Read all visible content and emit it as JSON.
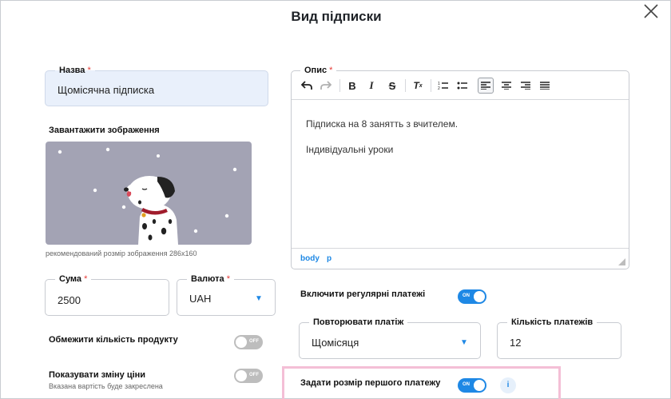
{
  "dialog": {
    "title": "Вид підписки"
  },
  "name": {
    "label": "Назва",
    "required_mark": "*",
    "value": "Щомісячна підписка"
  },
  "image_upload": {
    "label": "Завантажити зображення",
    "hint": "рекомендований розмір зображення 286x160"
  },
  "sum": {
    "label": "Сума",
    "required_mark": "*",
    "value": "2500"
  },
  "currency": {
    "label": "Валюта",
    "required_mark": "*",
    "value": "UAH"
  },
  "limit_product": {
    "label": "Обмежити кількість продукту",
    "toggle_text": "OFF",
    "enabled": false
  },
  "show_price_change": {
    "label": "Показувати зміну ціни",
    "sublabel": "Вказана вартість буде закреслена",
    "toggle_text": "OFF",
    "enabled": false
  },
  "description": {
    "label": "Опис",
    "required_mark": "*",
    "paragraphs": [
      "Підписка на 8 занятть з вчителем.",
      "Індивідуальні уроки"
    ],
    "status_path": [
      "body",
      "p"
    ]
  },
  "editor_toolbar": {
    "buttons": [
      {
        "name": "undo-icon",
        "glyph": "↶"
      },
      {
        "name": "redo-icon",
        "glyph": "↷"
      },
      {
        "name": "bold-icon",
        "glyph": "B"
      },
      {
        "name": "italic-icon",
        "glyph": "I"
      },
      {
        "name": "strikethrough-icon",
        "glyph": "S"
      },
      {
        "name": "clear-format-icon",
        "glyph": "Tx"
      },
      {
        "name": "ordered-list-icon",
        "glyph": "1≡"
      },
      {
        "name": "bullet-list-icon",
        "glyph": "•≡"
      },
      {
        "name": "align-left-icon",
        "glyph": "≡"
      },
      {
        "name": "align-center-icon",
        "glyph": "≡"
      },
      {
        "name": "align-right-icon",
        "glyph": "≡"
      },
      {
        "name": "align-justify-icon",
        "glyph": "≡"
      }
    ]
  },
  "recurring_payments": {
    "label": "Включити регулярні платежі",
    "toggle_text": "ON",
    "enabled": true
  },
  "repeat_payment": {
    "label": "Повторювати платіж",
    "value": "Щомісяця"
  },
  "payments_count": {
    "label": "Кількість платежів",
    "value": "12"
  },
  "first_payment": {
    "label": "Задати розмір першого платежу",
    "toggle_text": "ON",
    "enabled": true,
    "info_glyph": "i"
  },
  "colors": {
    "accent": "#1e88e5",
    "required": "#e53935",
    "highlight": "#f4bfd6",
    "name_field_bg": "#e9f0fb",
    "image_bg": "#a3a3b4"
  }
}
